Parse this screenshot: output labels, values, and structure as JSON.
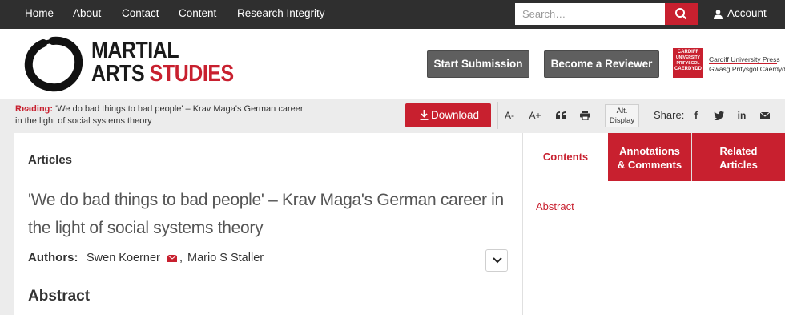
{
  "topnav": {
    "items": [
      {
        "label": "Home"
      },
      {
        "label": "About"
      },
      {
        "label": "Contact"
      },
      {
        "label": "Content"
      },
      {
        "label": "Research Integrity"
      }
    ],
    "search_placeholder": "Search…",
    "account_label": "Account"
  },
  "header": {
    "logo_line1": "MARTIAL",
    "logo_line2_a": "ARTS",
    "logo_line2_b": "STUDIES",
    "start_submission": "Start Submission",
    "become_reviewer": "Become a Reviewer",
    "cardiff_badge": [
      "CARDIFF",
      "UNIVERSITY",
      "PRIFYSGOL",
      "CAERDYDD"
    ],
    "press_line1": "Cardiff University Press",
    "press_line2": "Gwasg Prifysgol Caerdydd"
  },
  "toolbar": {
    "reading_label": "Reading:",
    "reading_title": "'We do bad things to bad people' – Krav Maga's German career in the light of social systems theory",
    "download": "Download",
    "font_decrease": "A-",
    "font_increase": "A+",
    "alt_display": "Alt. Display",
    "share_label": "Share:",
    "share_icons": [
      "facebook-icon",
      "twitter-icon",
      "linkedin-icon",
      "email-icon"
    ]
  },
  "article": {
    "section": "Articles",
    "title": "'We do bad things to bad people' – Krav Maga's German career in the light of social systems theory",
    "authors_label": "Authors:",
    "author1": "Swen Koerner",
    "author2": "Mario S Staller",
    "abstract_heading": "Abstract"
  },
  "sidebar": {
    "tab_contents": "Contents",
    "tab_annotations_line1": "Annotations",
    "tab_annotations_line2": "& Comments",
    "tab_related_line1": "Related",
    "tab_related_line2": "Articles",
    "contents_link": "Abstract"
  },
  "colors": {
    "brand_red": "#c8202f",
    "nav_bg": "#2f2f2f",
    "button_gray": "#5f5f5f"
  }
}
